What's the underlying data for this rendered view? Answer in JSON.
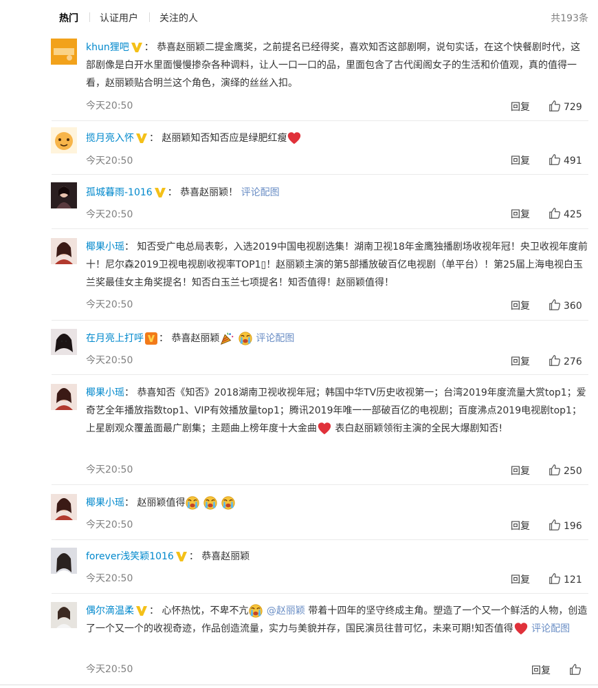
{
  "tabs": {
    "hot": "热门",
    "verified": "认证用户",
    "following": "关注的人",
    "total": "共193条"
  },
  "labels": {
    "reply": "回复",
    "comment_pic": "评论配图"
  },
  "colors": {
    "username": "#eb7350",
    "link": "#6a8ec5",
    "verified_badge": "#f4c018",
    "timestamp": "#808080"
  },
  "comments": [
    {
      "user": "khun狸吧",
      "badge": "verified-yellow",
      "text": "恭喜赵丽颖二提金鹰奖，之前提名已经得奖，喜欢知否这部剧啊，说句实话，在这个快餐剧时代，这部剧像是白开水里面慢慢掺杂各种调料，让人一口一口的品，里面包含了古代闺阁女子的生活和价值观，真的值得一看，赵丽颖贴合明兰这个角色，演绎的丝丝入扣。",
      "time": "今天20:50",
      "likes": "729"
    },
    {
      "user": "揽月亮入怀",
      "badge": "verified-yellow",
      "text": "赵丽颖知否知否应是绿肥红瘦",
      "emoji_after": "heart-emoji",
      "time": "今天20:50",
      "likes": "491"
    },
    {
      "user": "孤城暮雨-1016",
      "badge": "verified-yellow",
      "text": "恭喜赵丽颖！",
      "time": "今天20:50",
      "likes": "425"
    },
    {
      "user": "椰果小瑶",
      "text": "知否受广电总局表彰，入选2019中国电视剧选集！湖南卫视18年金鹰独播剧场收视年冠！央卫收视年度前十！尼尔森2019卫视电视剧收视率TOP1▯！赵丽颖主演的第5部播放破百亿电视剧（单平台）！第25届上海电视白玉兰奖最佳女主角奖提名！知否白玉兰七项提名！知否值得！赵丽颖值得！",
      "time": "今天20:50",
      "likes": "360"
    },
    {
      "user": "在月亮上打呼",
      "badge": "verified-orange",
      "text": "恭喜赵丽颖",
      "time": "今天20:50",
      "likes": "276"
    },
    {
      "user": "椰果小瑶",
      "text_part1": "恭喜知否《知否》2018湖南卫视收视年冠；韩国中华TV历史收视第一；台湾2019年度流量大赏top1；爱奇艺全年播放指数top1、VIP有效播放量top1；腾讯2019年唯一一部破百亿的电视剧；百度沸点2019电视剧top1；上星剧观众覆盖面最广剧集；主题曲上榜年度十大金曲",
      "text_part2": "表白赵丽颖领衔主演的全民大爆剧知否!",
      "time": "今天20:50",
      "likes": "250"
    },
    {
      "user": "椰果小瑶",
      "text": "赵丽颖值得",
      "time": "今天20:50",
      "likes": "196"
    },
    {
      "user": "forever浅笑颖1016",
      "badge": "verified-yellow",
      "text": "恭喜赵丽颖",
      "time": "今天20:50",
      "likes": "121"
    },
    {
      "user": "偶尔滴温柔",
      "badge": "verified-yellow",
      "text_part1": "心怀热忱，不卑不亢",
      "mention": "@赵丽颖",
      "text_part2": "带着十四年的坚守终成主角。塑造了一个又一个鲜活的人物，创造了一个又一个的收视奇迹，作品创造流量，实力与美貌并存，国民演员往昔可忆，未来可期!知否值得",
      "time": "今天20:50",
      "likes": ""
    }
  ]
}
